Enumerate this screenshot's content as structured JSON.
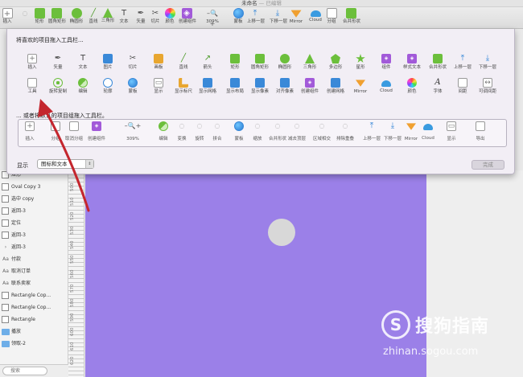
{
  "window": {
    "title": "未命名",
    "edited": "— 已编辑"
  },
  "app_toolbar": [
    {
      "label": "插入",
      "icon": "plus-icon"
    },
    {
      "label": "",
      "icon": "brush-icon"
    },
    {
      "label": "矩形",
      "icon": "rectangle-icon"
    },
    {
      "label": "圆角矩形",
      "icon": "rounded-rectangle-icon"
    },
    {
      "label": "椭圆形",
      "icon": "oval-icon"
    },
    {
      "label": "直线",
      "icon": "line-icon"
    },
    {
      "label": "三角形",
      "icon": "triangle-icon"
    },
    {
      "label": "文本",
      "icon": "text-icon"
    },
    {
      "label": "矢量",
      "icon": "vector-icon"
    },
    {
      "label": "切片",
      "icon": "slice-icon"
    },
    {
      "label": "颜色",
      "icon": "color-icon"
    },
    {
      "label": "创建组件",
      "icon": "create-symbol-icon"
    },
    {
      "label": "309%",
      "icon": "zoom-icon"
    },
    {
      "label": "蒙板",
      "icon": "mask-icon"
    },
    {
      "label": "上移一层",
      "icon": "forward-icon"
    },
    {
      "label": "下移一层",
      "icon": "backward-icon"
    },
    {
      "label": "Mirror",
      "icon": "mirror-icon"
    },
    {
      "label": "Cloud",
      "icon": "cloud-icon"
    },
    {
      "label": "分组",
      "icon": "group-icon"
    },
    {
      "label": "合并形状",
      "icon": "combine-shapes-icon"
    }
  ],
  "customize": {
    "title": "将喜欢的项目拖入工具栏...",
    "row1": [
      {
        "label": "插入",
        "icon": "plus-icon"
      },
      {
        "label": "矢量",
        "icon": "vector-icon"
      },
      {
        "label": "文本",
        "icon": "text-icon"
      },
      {
        "label": "图片",
        "icon": "image-icon"
      },
      {
        "label": "切片",
        "icon": "slice-icon"
      },
      {
        "label": "画板",
        "icon": "artboard-icon"
      },
      {
        "label": "直线",
        "icon": "line-icon"
      },
      {
        "label": "箭头",
        "icon": "arrow-icon"
      },
      {
        "label": "矩形",
        "icon": "rectangle-icon"
      },
      {
        "label": "圆角矩形",
        "icon": "rounded-rectangle-icon"
      },
      {
        "label": "椭圆形",
        "icon": "oval-icon"
      },
      {
        "label": "三角形",
        "icon": "triangle-icon"
      },
      {
        "label": "多边形",
        "icon": "polygon-icon"
      },
      {
        "label": "星形",
        "icon": "star-icon"
      },
      {
        "label": "组件",
        "icon": "symbol-icon"
      },
      {
        "label": "样式文本",
        "icon": "styled-text-icon"
      },
      {
        "label": "合并形状",
        "icon": "combine-shapes-icon"
      },
      {
        "label": "上移一层",
        "icon": "forward-icon"
      },
      {
        "label": "下移一层",
        "icon": "backward-icon"
      }
    ],
    "row2": [
      {
        "label": "工具",
        "icon": "tools-icon"
      },
      {
        "label": "旋转复制",
        "icon": "rotate-copies-icon"
      },
      {
        "label": "编辑",
        "icon": "edit-icon"
      },
      {
        "label": "轮廓",
        "icon": "outline-icon"
      },
      {
        "label": "蒙板",
        "icon": "mask-icon"
      },
      {
        "label": "显示",
        "icon": "view-icon"
      },
      {
        "label": "显示标尺",
        "icon": "show-rulers-icon"
      },
      {
        "label": "显示网格",
        "icon": "show-grid-icon"
      },
      {
        "label": "显示布局",
        "icon": "show-layout-icon"
      },
      {
        "label": "显示像素",
        "icon": "show-pixels-icon"
      },
      {
        "label": "对齐像素",
        "icon": "align-pixels-icon"
      },
      {
        "label": "创建组件",
        "icon": "create-symbol-icon"
      },
      {
        "label": "创建网格",
        "icon": "make-grid-icon"
      },
      {
        "label": "Mirror",
        "icon": "mirror-icon"
      },
      {
        "label": "Cloud",
        "icon": "cloud-icon"
      },
      {
        "label": "颜色",
        "icon": "color-icon"
      },
      {
        "label": "字体",
        "icon": "font-icon"
      },
      {
        "label": "间距",
        "icon": "space-icon"
      },
      {
        "label": "可调间距",
        "icon": "flexible-space-icon"
      }
    ],
    "default_title": "... 或者将默认的项目组拖入工具栏。",
    "default_set": [
      {
        "label": "插入",
        "icon": "plus-icon"
      },
      {
        "label": "分组",
        "icon": "group-icon"
      },
      {
        "label": "取消分组",
        "icon": "ungroup-icon"
      },
      {
        "label": "创建组件",
        "icon": "create-symbol-icon"
      },
      {
        "label": "309%",
        "icon": "zoom-icon"
      },
      {
        "label": "编辑",
        "icon": "edit-icon"
      },
      {
        "label": "变换",
        "icon": "transform-icon"
      },
      {
        "label": "旋转",
        "icon": "rotate-icon"
      },
      {
        "label": "拼合",
        "icon": "flatten-icon"
      },
      {
        "label": "蒙板",
        "icon": "mask-icon"
      },
      {
        "label": "缩放",
        "icon": "scale-icon"
      },
      {
        "label": "合并形状",
        "icon": "union-icon"
      },
      {
        "label": "减去顶层",
        "icon": "subtract-icon"
      },
      {
        "label": "区域相交",
        "icon": "intersect-icon"
      },
      {
        "label": "排除重叠",
        "icon": "difference-icon"
      },
      {
        "label": "上移一层",
        "icon": "forward-icon"
      },
      {
        "label": "下移一层",
        "icon": "backward-icon"
      },
      {
        "label": "Mirror",
        "icon": "mirror-icon"
      },
      {
        "label": "Cloud",
        "icon": "cloud-icon"
      },
      {
        "label": "显示",
        "icon": "view-icon"
      },
      {
        "label": "导出",
        "icon": "export-icon"
      }
    ],
    "show_label": "显示",
    "show_value": "图标和文本",
    "done_label": "完成"
  },
  "layers": [
    {
      "name": "矩形",
      "icon": "box"
    },
    {
      "name": "Oval Copy 3",
      "icon": "box"
    },
    {
      "name": "选中 copy",
      "icon": "box"
    },
    {
      "name": "返回-3",
      "icon": "box"
    },
    {
      "name": "定位",
      "icon": "box"
    },
    {
      "name": "返回-3",
      "icon": "box"
    },
    {
      "name": "返回-3",
      "icon": "chevron"
    },
    {
      "name": "付款",
      "icon": "text"
    },
    {
      "name": "取消订单",
      "icon": "text"
    },
    {
      "name": "联系卖家",
      "icon": "text"
    },
    {
      "name": "Rectangle Cop...",
      "icon": "box"
    },
    {
      "name": "Rectangle Cop...",
      "icon": "box"
    },
    {
      "name": "Rectangle",
      "icon": "box"
    },
    {
      "name": "播放",
      "icon": "folder"
    },
    {
      "name": "领取-2",
      "icon": "folder"
    }
  ],
  "ruler": [
    "500",
    "510",
    "520",
    "530",
    "540",
    "550",
    "560",
    "570",
    "580",
    "590",
    "600",
    "610",
    "620"
  ],
  "search_placeholder": "搜索",
  "watermark": {
    "brand_cn": "搜狗指南",
    "url": "zhinan.sogou.com",
    "logo_letter": "S"
  },
  "colors": {
    "artboard": "#9b80e8",
    "accent_green": "#6cbf3c",
    "annotation": "#c4262e"
  }
}
